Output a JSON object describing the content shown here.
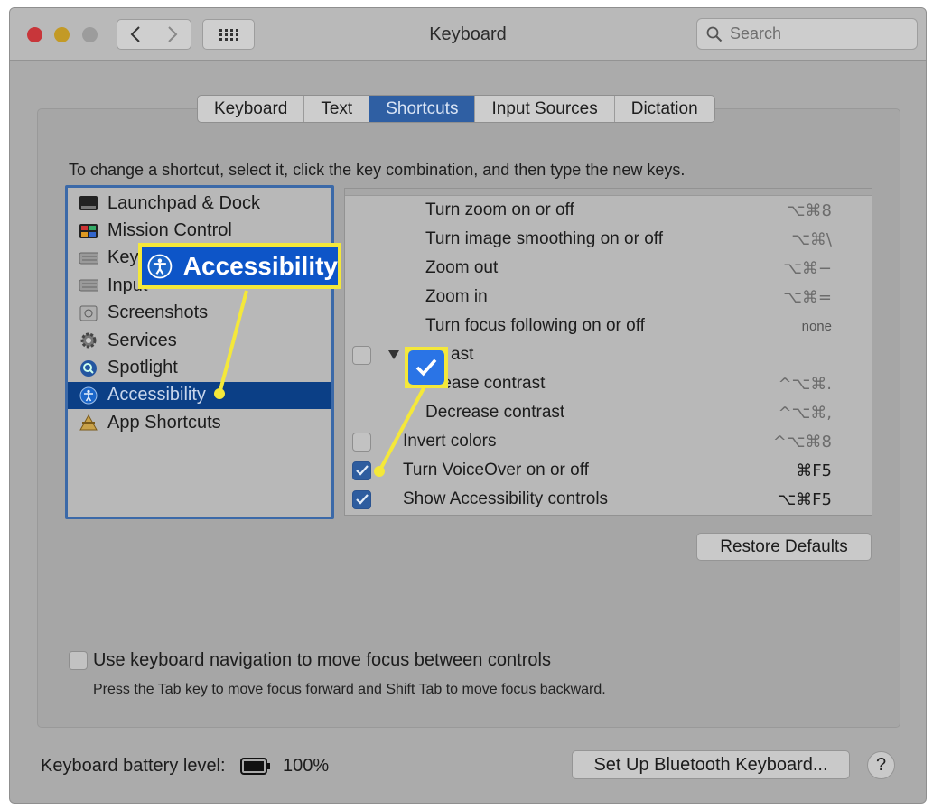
{
  "window": {
    "title": "Keyboard"
  },
  "search": {
    "placeholder": "Search"
  },
  "tabs": [
    {
      "label": "Keyboard",
      "active": false
    },
    {
      "label": "Text",
      "active": false
    },
    {
      "label": "Shortcuts",
      "active": true
    },
    {
      "label": "Input Sources",
      "active": false
    },
    {
      "label": "Dictation",
      "active": false
    }
  ],
  "instructions": "To change a shortcut, select it, click the key combination, and then type the new keys.",
  "categories": [
    {
      "label": "Launchpad & Dock",
      "icon": "launchpad-dock-icon"
    },
    {
      "label": "Mission Control",
      "icon": "mission-control-icon"
    },
    {
      "label": "Keyb",
      "icon": "keyboard-icon"
    },
    {
      "label": "Input",
      "icon": "input-sources-icon"
    },
    {
      "label": "Screenshots",
      "icon": "screenshots-icon"
    },
    {
      "label": "Services",
      "icon": "services-gear-icon"
    },
    {
      "label": "Spotlight",
      "icon": "spotlight-icon"
    },
    {
      "label": "Accessibility",
      "icon": "accessibility-icon",
      "selected": true
    },
    {
      "label": "App Shortcuts",
      "icon": "app-shortcuts-icon"
    }
  ],
  "shortcuts": [
    {
      "label": "Turn zoom on or off",
      "key": "⌥⌘8",
      "checkbox": null
    },
    {
      "label": "Turn image smoothing on or off",
      "key": "⌥⌘\\",
      "checkbox": null
    },
    {
      "label": "Zoom out",
      "key": "⌥⌘−",
      "checkbox": null
    },
    {
      "label": "Zoom in",
      "key": "⌥⌘=",
      "checkbox": null
    },
    {
      "label": "Turn focus following on or off",
      "key": "none",
      "checkbox": null
    },
    {
      "label": "ast",
      "key": "",
      "checkbox": "unchecked"
    },
    {
      "label": "rease contrast",
      "key": "^⌥⌘.",
      "checkbox": null
    },
    {
      "label": "Decrease contrast",
      "key": "^⌥⌘,",
      "checkbox": null
    },
    {
      "label": "Invert colors",
      "key": "^⌥⌘8",
      "checkbox": "unchecked"
    },
    {
      "label": "Turn VoiceOver on or off",
      "key": "⌘F5",
      "checkbox": "checked"
    },
    {
      "label": "Show Accessibility controls",
      "key": "⌥⌘F5",
      "checkbox": "checked"
    }
  ],
  "restore_label": "Restore Defaults",
  "keyboard_nav": {
    "label": "Use keyboard navigation to move focus between controls",
    "help": "Press the Tab key to move focus forward and Shift Tab to move focus backward."
  },
  "battery": {
    "label": "Keyboard battery level:",
    "value": "100%"
  },
  "bluetooth_label": "Set Up Bluetooth Keyboard...",
  "help_label": "?",
  "callout": {
    "label": "Accessibility"
  },
  "colors": {
    "accent": "#2f5fa3",
    "callout_yellow": "#f4e83a",
    "callout_blue": "#0d55c8"
  }
}
